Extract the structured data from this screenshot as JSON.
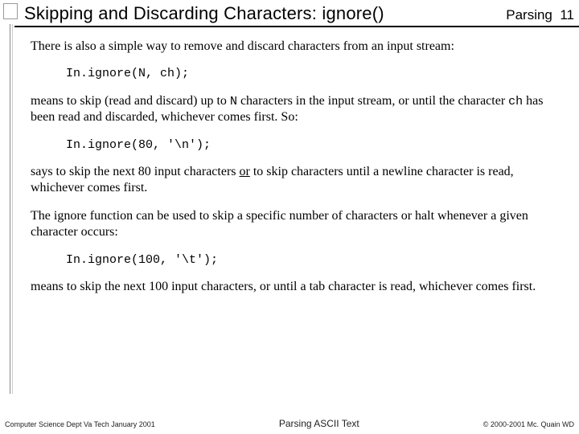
{
  "header": {
    "title": "Skipping and Discarding Characters:  ignore()",
    "section": "Parsing",
    "page": "11"
  },
  "body": {
    "p1": "There is also a simple way to remove and discard characters from an input stream:",
    "code1": "In.ignore(N, ch);",
    "p2a": "means to skip (read and discard) up to ",
    "p2_code_N": "N",
    "p2b": " characters in the input stream, or until the character ",
    "p2_code_ch": "ch",
    "p2c": " has been read and discarded, whichever comes first.  So:",
    "code2": "In.ignore(80, '\\n');",
    "p3a": "says to skip the next 80 input characters ",
    "p3_or": "or",
    "p3b": " to skip characters until a newline character is read, whichever comes first.",
    "p4": "The ignore function can be used to skip a specific number of characters or halt whenever a given character occurs:",
    "code3": "In.ignore(100, '\\t');",
    "p5": "means to skip the next 100 input characters, or until a tab character is read, whichever comes first."
  },
  "footer": {
    "left": "Computer Science Dept Va Tech January 2001",
    "center": "Parsing ASCII Text",
    "right": "© 2000-2001  Mc. Quain WD"
  }
}
